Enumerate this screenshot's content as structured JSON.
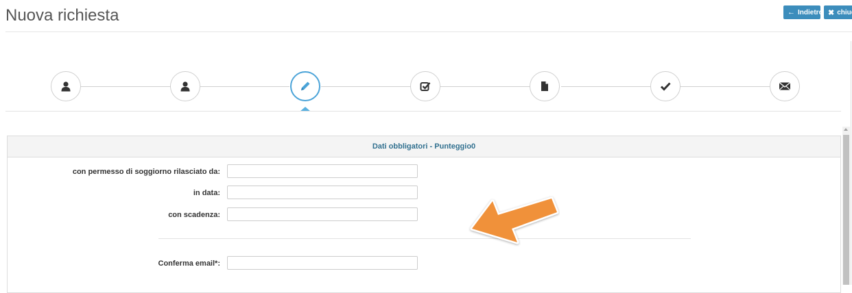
{
  "header": {
    "title": "Nuova richiesta",
    "back_label": "Indietro",
    "close_label": "chiud"
  },
  "wizard": {
    "steps": [
      {
        "icon": "user-icon"
      },
      {
        "icon": "user-icon"
      },
      {
        "icon": "pencil-icon",
        "active": true
      },
      {
        "icon": "check-square-icon"
      },
      {
        "icon": "file-icon"
      },
      {
        "icon": "checkmark-icon"
      },
      {
        "icon": "envelope-icon"
      }
    ],
    "active_color": "#4aa3d8"
  },
  "panel": {
    "title": "Dati obbligatori - Punteggio0",
    "fields": [
      {
        "label": "con permesso di soggiorno rilasciato da:",
        "value": ""
      },
      {
        "label": "in data:",
        "value": ""
      },
      {
        "label": "con scadenza:",
        "value": ""
      },
      {
        "label": "Conferma email*:",
        "value": ""
      }
    ]
  },
  "annotation": {
    "icon": "orange-arrow",
    "color": "#f0913a"
  }
}
